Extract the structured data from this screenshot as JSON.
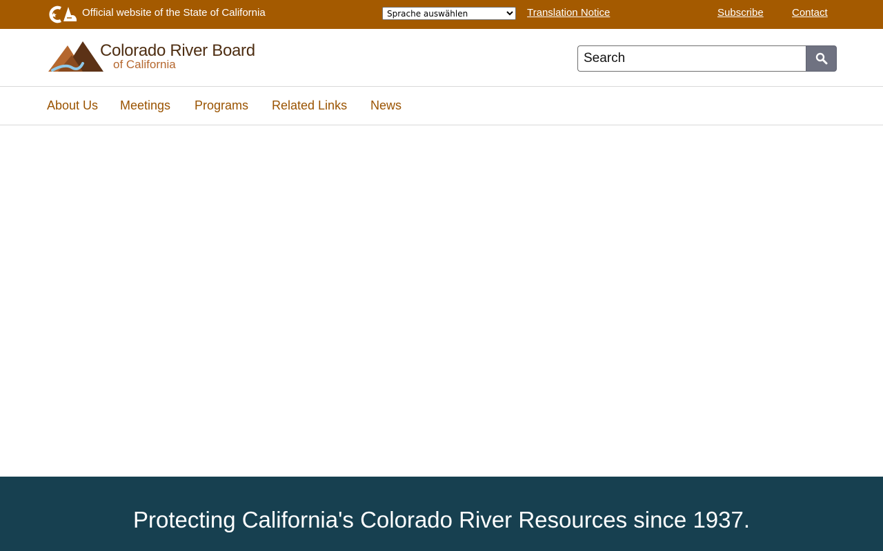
{
  "utility_bar": {
    "official_text": "Official website of the State of California",
    "language_select": {
      "selected": "Sprache auswählen",
      "options": [
        "Sprache auswählen"
      ]
    },
    "translation_notice": "Translation Notice",
    "subscribe": "Subscribe",
    "contact": "Contact",
    "ca_logo_icon": "ca-state-logo-icon"
  },
  "header": {
    "logo": {
      "title": "Colorado River Board",
      "subtitle": "of California"
    },
    "search": {
      "placeholder": "Search",
      "button_icon": "search-icon"
    }
  },
  "nav": {
    "items": [
      {
        "label": "About Us"
      },
      {
        "label": "Meetings"
      },
      {
        "label": "Programs"
      },
      {
        "label": "Related Links"
      },
      {
        "label": "News"
      }
    ]
  },
  "banner": {
    "text": "Protecting California's Colorado River Resources since 1937."
  },
  "colors": {
    "utility_bar": "#a45a00",
    "nav_link": "#9a5300",
    "banner": "#174050",
    "search_button": "#6f7281"
  }
}
